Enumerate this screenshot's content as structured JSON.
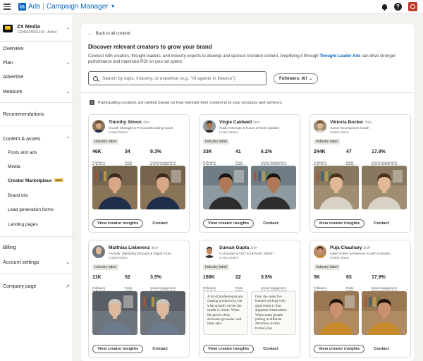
{
  "topbar": {
    "brand_ads": "Ads",
    "brand_product": "Campaign Manager",
    "help_glyph": "?"
  },
  "account": {
    "name": "ZX Media",
    "sub": "12345678901234 · Active"
  },
  "sidebar": {
    "overview": "Overview",
    "plan": "Plan",
    "advertise": "Advertise",
    "measure": "Measure",
    "recommendations": "Recommendations",
    "content_assets": "Content & assets",
    "posts_ads": "Posts and ads",
    "media": "Media",
    "creator_marketplace": "Creator Marketplace",
    "new_badge": "NEW",
    "brand_kits": "Brand kits",
    "lead_gen": "Lead generation forms",
    "landing_pages": "Landing pages",
    "billing": "Billing",
    "account_settings": "Account settings",
    "company_page": "Company page"
  },
  "main": {
    "back": "Back to all content",
    "heading": "Discover relevant creators to grow your brand",
    "desc_before": "Connect with creators, thought leaders, and industry experts to develop and sponsor branded content. Amplifying it through ",
    "desc_link": "Thought Leader Ads",
    "desc_after": " can drive stronger performance and maximize ROI on your ad spend.",
    "search_placeholder": "Search by topic, industry, or expertise (e.g. \"AI agents in finance\")",
    "filter_label": "Followers: All",
    "info_text": "Participating creators are ranked based on how relevant their content is to your products and services.",
    "stat_labels": [
      "Followers",
      "Posts",
      "Social engagement"
    ],
    "insights_label": "View creator insights",
    "contact_label": "Contact"
  },
  "creators": [
    {
      "name": "Timothy Simon",
      "degree": "3rd+",
      "title": "Growth Strategist & Personal Branding Coach",
      "location": "United States",
      "industry": "Industry label",
      "followers": "46K",
      "posts": "34",
      "engagement": "9.3%"
    },
    {
      "name": "Virgie Caldwell",
      "degree": "3rd+",
      "title": "Public Advocate & Future of Work Speaker",
      "location": "United States",
      "industry": "Industry label",
      "followers": "33K",
      "posts": "41",
      "engagement": "6.2%"
    },
    {
      "name": "Viktoria Bocker",
      "degree": "3rd+",
      "title": "Career Development Coach",
      "location": "United States",
      "industry": "Industry label",
      "followers": "244K",
      "posts": "47",
      "engagement": "17.9%"
    },
    {
      "name": "Matthias Lieberenz",
      "degree": "3rd+",
      "title": "Founder, Marketing Educator & Digital Grow...",
      "location": "United States",
      "industry": "Industry label",
      "followers": "11K",
      "posts": "52",
      "engagement": "3.5%"
    },
    {
      "name": "Suman Gupta",
      "degree": "3rd+",
      "title": "Co-founder & CEO at Ulchool | Edtech",
      "location": "United States",
      "industry": "Industry label",
      "followers": "166K",
      "posts": "22",
      "engagement": "3.5%"
    },
    {
      "name": "Puja Chauhary",
      "degree": "3rd+",
      "title": "Sales Trainer & Revenue Growth Consulta...",
      "location": "United States",
      "industry": "Industry label",
      "followers": "5K",
      "posts": "63",
      "engagement": "17.9%"
    }
  ],
  "text_post_1": "A lot of professionals are chasing productivity, but what actually moves the needle is clarity. When the goal is clear, decisions get easier, and ideas take",
  "text_post_2": "Over the years I've learned working with great teams is that alignment beats talent. When smart people pulling in different directions creates friction, but"
}
